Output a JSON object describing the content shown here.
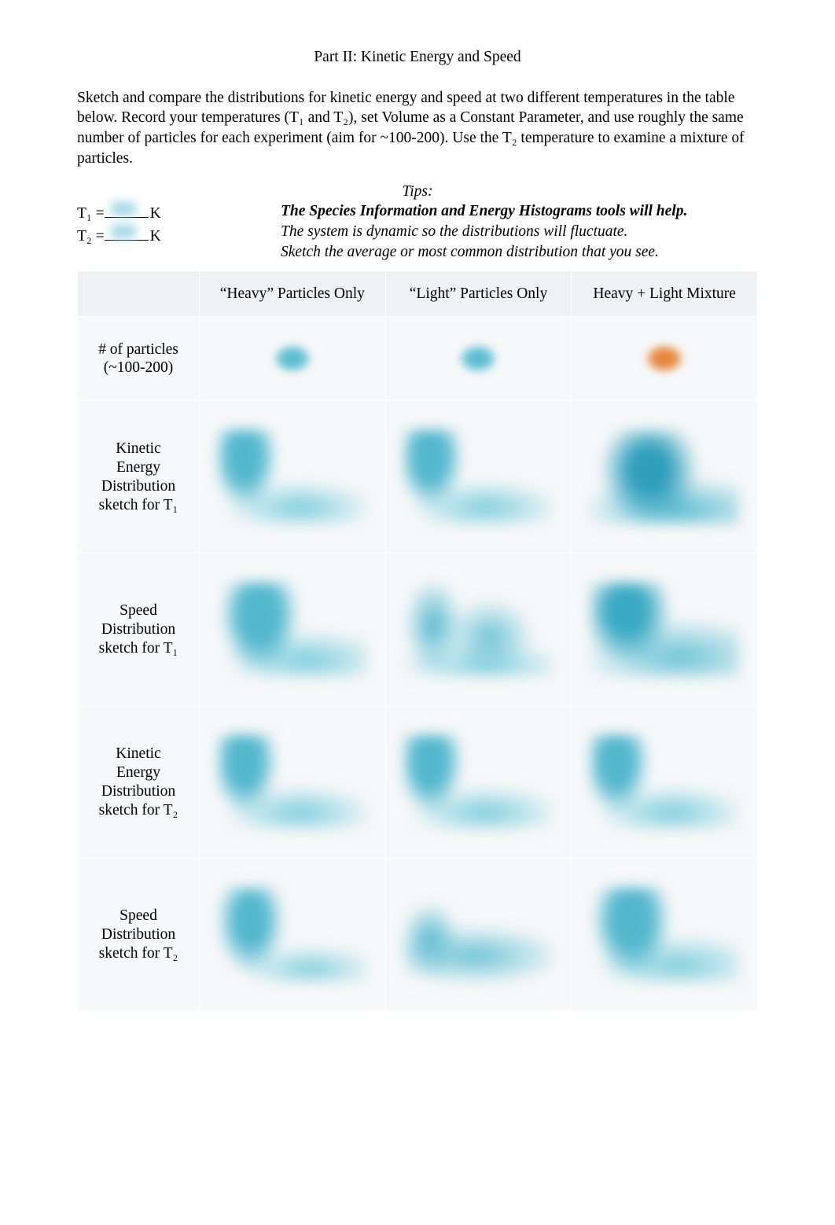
{
  "title": "Part II: Kinetic Energy and Speed",
  "intro": "Sketch and compare the distributions for kinetic energy and speed at two different temperatures in the table below.  Record your temperatures (T₁ and T₂), set Volume as a Constant Parameter, and use roughly the same number of particles for each experiment (aim for ~100-200).  Use the T₂ temperature to examine a mixture of particles.",
  "tips_label": "Tips:",
  "temps": {
    "t1_prefix": "T₁ = ",
    "t1_suffix": "K",
    "t2_prefix": "T₂ = ",
    "t2_suffix": "K"
  },
  "tips": {
    "line1": "The Species Information and Energy Histograms tools will help.",
    "line2": "The system is dynamic so the distributions will fluctuate.",
    "line3": "Sketch the average or most common distribution that you see."
  },
  "table": {
    "headers": {
      "blank": "",
      "heavy": "“Heavy” Particles Only",
      "light": "“Light” Particles Only",
      "mix": "Heavy + Light Mixture"
    },
    "rows": {
      "np": "# of particles\n(~100-200)",
      "ke_t1": "Kinetic\nEnergy\nDistribution\nsketch for T₁",
      "spd_t1": "Speed\nDistribution\nsketch for T₁",
      "ke_t2": "Kinetic\nEnergy\nDistribution\nsketch for T₂",
      "spd_t2": "Speed\nDistribution\nsketch for T₂"
    }
  }
}
